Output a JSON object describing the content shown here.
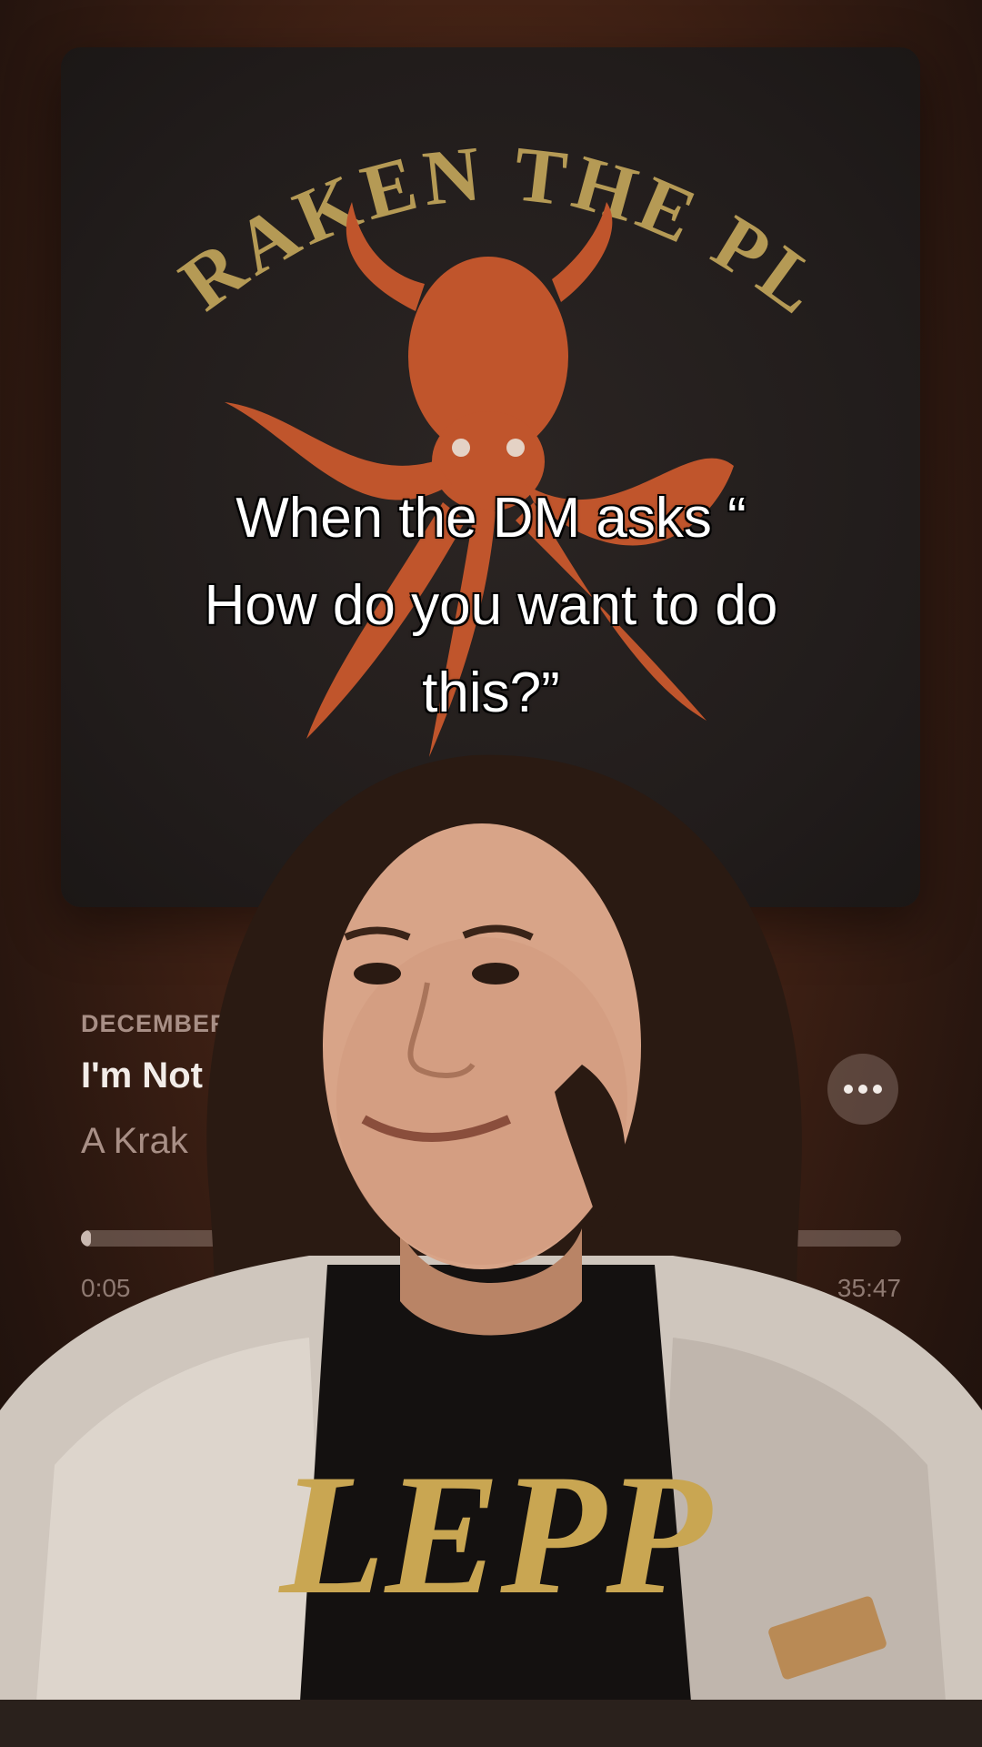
{
  "album": {
    "art_title": "A KRAKEN THE PLAN",
    "colors": {
      "background": "#211c1b",
      "title_text": "#b59a55",
      "octopus": "#c0552c"
    }
  },
  "player": {
    "label": "DECEMBER",
    "track_title": "I'm Not",
    "artist": "A Krak",
    "time_elapsed": "0:05",
    "time_remaining": "35:47",
    "progress_fraction": 0.0023,
    "more_icon": "more-horizontal-icon"
  },
  "caption": {
    "lines": [
      "When the DM asks “",
      "How do you want to do",
      "this?”"
    ]
  },
  "overlay": {
    "shirt_text": "LEPP"
  }
}
